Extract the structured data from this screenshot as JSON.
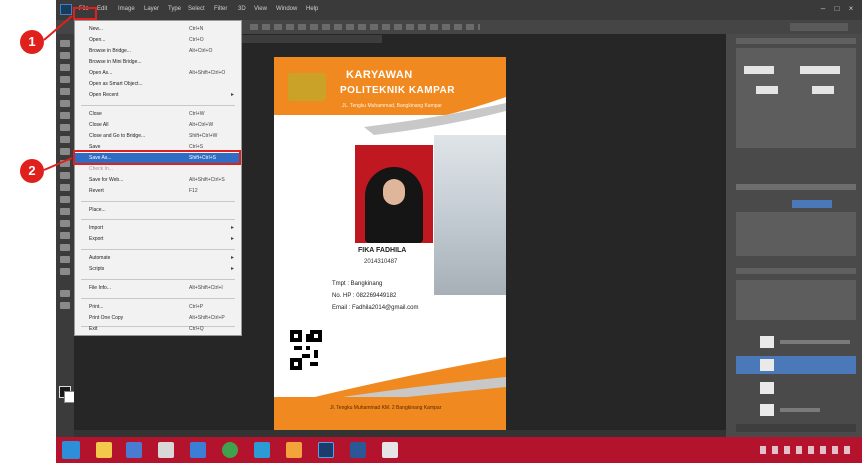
{
  "menubar": {
    "items": [
      "File",
      "Edit",
      "Image",
      "Layer",
      "Type",
      "Select",
      "Filter",
      "3D",
      "View",
      "Window",
      "Help"
    ]
  },
  "window": {
    "minimize": "–",
    "maximize": "□",
    "close": "×"
  },
  "file_menu": {
    "items": [
      {
        "label": "New...",
        "shortcut": "Ctrl+N"
      },
      {
        "label": "Open...",
        "shortcut": "Ctrl+O"
      },
      {
        "label": "Browse in Bridge...",
        "shortcut": "Alt+Ctrl+O"
      },
      {
        "label": "Browse in Mini Bridge...",
        "shortcut": ""
      },
      {
        "label": "Open As...",
        "shortcut": "Alt+Shift+Ctrl+O"
      },
      {
        "label": "Open as Smart Object...",
        "shortcut": ""
      },
      {
        "label": "Open Recent",
        "shortcut": "",
        "submenu": true
      },
      {
        "label": "Close",
        "shortcut": "Ctrl+W"
      },
      {
        "label": "Close All",
        "shortcut": "Alt+Ctrl+W"
      },
      {
        "label": "Close and Go to Bridge...",
        "shortcut": "Shift+Ctrl+W"
      },
      {
        "label": "Save",
        "shortcut": "Ctrl+S"
      },
      {
        "label": "Save As...",
        "shortcut": "Shift+Ctrl+S",
        "highlighted": true
      },
      {
        "label": "Check In...",
        "shortcut": ""
      },
      {
        "label": "Save for Web...",
        "shortcut": "Alt+Shift+Ctrl+S"
      },
      {
        "label": "Revert",
        "shortcut": "F12"
      },
      {
        "label": "Place...",
        "shortcut": ""
      },
      {
        "label": "Import",
        "shortcut": "",
        "submenu": true
      },
      {
        "label": "Export",
        "shortcut": "",
        "submenu": true
      },
      {
        "label": "Automate",
        "shortcut": "",
        "submenu": true
      },
      {
        "label": "Scripts",
        "shortcut": "",
        "submenu": true
      },
      {
        "label": "File Info...",
        "shortcut": "Alt+Shift+Ctrl+I"
      },
      {
        "label": "Print...",
        "shortcut": "Ctrl+P"
      },
      {
        "label": "Print One Copy",
        "shortcut": "Alt+Shift+Ctrl+P"
      },
      {
        "label": "Exit",
        "shortcut": "Ctrl+Q"
      }
    ]
  },
  "document": {
    "title_line1": "KARYAWAN",
    "title_line2": "POLITEKNIK KAMPAR",
    "subtitle": "JL. Tengku Muhammad, Bangkinang Kampar",
    "person_name": "FIKA FADHILA",
    "person_id": "2014310487",
    "info": [
      "Tmpt : Bangkinang",
      "No. HP : 082269449182",
      "Email : Fadhila2014@gmail.com"
    ],
    "footer": "Jl. Tengku Muhammad KM. 2 Bangkinang Kampar"
  },
  "annotations": {
    "step1": "1",
    "step2": "2"
  },
  "colors": {
    "accent_orange": "#f0891f",
    "highlight_red": "#e0201c",
    "menu_selection": "#2f6dc4",
    "taskbar": "#b3132d"
  }
}
